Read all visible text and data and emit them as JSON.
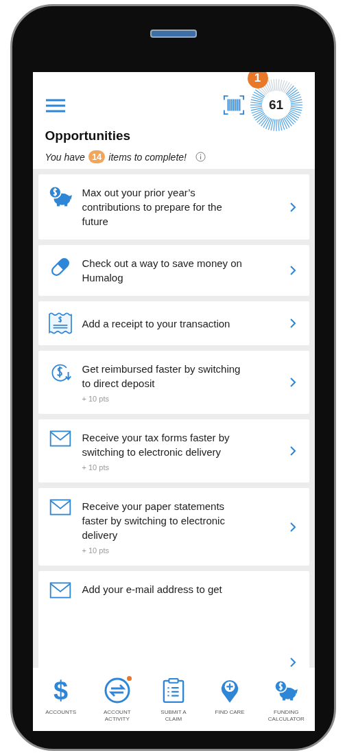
{
  "header": {
    "score": "61",
    "score_badge": "1",
    "title": "Opportunities",
    "subtitle_before": "You have",
    "count": "14",
    "subtitle_after": "items to complete!"
  },
  "opportunities": [
    {
      "kind": "piggy",
      "text": "Max out your prior year’s contributions to prepare for the future"
    },
    {
      "kind": "pill",
      "text": "Check out a way to save money on Humalog"
    },
    {
      "kind": "receipt",
      "text": "Add a receipt to your transaction"
    },
    {
      "kind": "deposit",
      "text": "Get reimbursed faster by switching to direct deposit",
      "points": "+ 10 pts"
    },
    {
      "kind": "envelope",
      "text": "Receive your tax forms faster by switching to electronic delivery",
      "points": "+ 10 pts"
    },
    {
      "kind": "envelope",
      "text": "Receive your paper statements faster by switching to electronic delivery",
      "points": "+ 10 pts"
    },
    {
      "kind": "envelope",
      "text": "Add your e-mail address to get"
    }
  ],
  "nav": [
    {
      "kind": "dollar",
      "glyph": "$",
      "label": "ACCOUNTS",
      "notification": false
    },
    {
      "kind": "transfer",
      "label": "ACCOUNT ACTIVITY",
      "notification": true
    },
    {
      "kind": "clipboard",
      "label": "SUBMIT A CLAIM",
      "notification": false
    },
    {
      "kind": "pin",
      "label": "FIND CARE",
      "notification": false
    },
    {
      "kind": "piggy",
      "label": "FUNDING CALCULATOR",
      "notification": false
    }
  ]
}
